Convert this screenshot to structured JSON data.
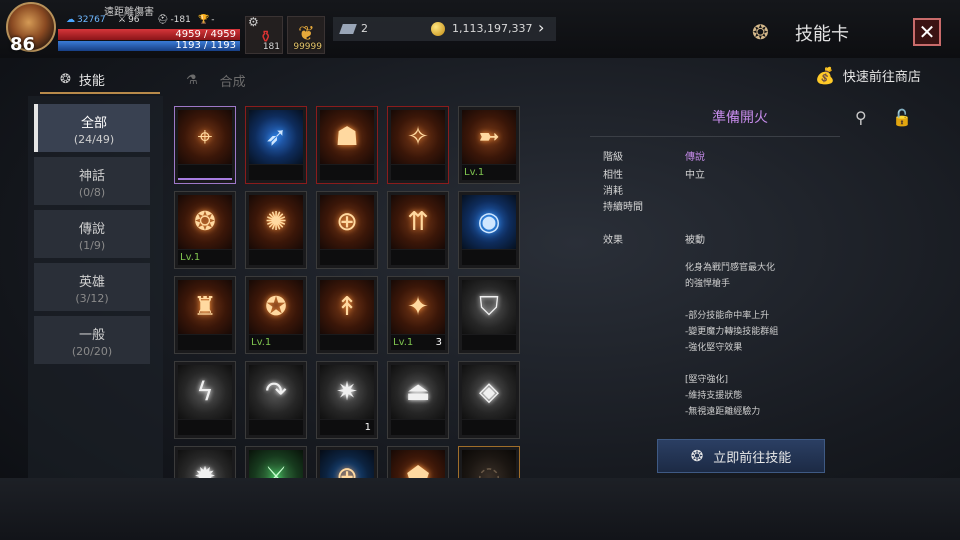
{
  "player": {
    "level": "86",
    "title": "遠距離傷害",
    "power": "32767",
    "stat_attack": "96",
    "stat_defense": "-181",
    "stat_trophy": "-",
    "hp": "4959 / 4959",
    "mp": "1193 / 1193",
    "potion_count": "181",
    "item_count": "99999"
  },
  "currency": {
    "gem_count": "2",
    "gold": "1,113,197,337"
  },
  "header": {
    "screen_title": "技能卡",
    "close_label": "✕"
  },
  "tabs": [
    {
      "label": "技能",
      "active": true
    },
    {
      "label": "合成",
      "active": false
    }
  ],
  "shop_link": "快速前往商店",
  "filters": [
    {
      "name": "全部",
      "count": "(24/49)",
      "active": true
    },
    {
      "name": "神話",
      "count": "(0/8)",
      "active": false
    },
    {
      "name": "傳說",
      "count": "(1/9)",
      "active": false
    },
    {
      "name": "英雄",
      "count": "(3/12)",
      "active": false
    },
    {
      "name": "一般",
      "count": "(20/20)",
      "active": false
    }
  ],
  "skills": [
    {
      "icon": "crosshair-shooter-icon",
      "glyph": "⌖",
      "style": "b-sel",
      "label": "",
      "num": ""
    },
    {
      "icon": "blue-dash-icon",
      "glyph": "➶",
      "style": "blue b-red",
      "label": "",
      "num": ""
    },
    {
      "icon": "demon-card-icon",
      "glyph": "☗",
      "style": "b-red",
      "label": "",
      "num": ""
    },
    {
      "icon": "shattered-ammo-icon",
      "glyph": "✧",
      "style": "b-red",
      "label": "",
      "num": ""
    },
    {
      "icon": "bullet-rush-icon",
      "glyph": "➼",
      "style": "",
      "label": "Lv.1",
      "num": ""
    },
    {
      "icon": "whirlwind-icon",
      "glyph": "❂",
      "style": "",
      "label": "Lv.1",
      "num": ""
    },
    {
      "icon": "explosion-icon",
      "glyph": "✺",
      "style": "",
      "label": "",
      "num": ""
    },
    {
      "icon": "stat-boost-icon",
      "glyph": "⊕",
      "style": "",
      "label": "",
      "num": ""
    },
    {
      "icon": "speed-up-icon",
      "glyph": "⇈",
      "style": "",
      "label": "",
      "num": ""
    },
    {
      "icon": "blue-whirl-icon",
      "glyph": "◉",
      "style": "blue",
      "label": "",
      "num": ""
    },
    {
      "icon": "armor-icon",
      "glyph": "♜",
      "style": "",
      "label": "",
      "num": ""
    },
    {
      "icon": "rage-body-icon",
      "glyph": "✪",
      "style": "",
      "label": "Lv.1",
      "num": ""
    },
    {
      "icon": "power-up-icon",
      "glyph": "↟",
      "style": "",
      "label": "",
      "num": ""
    },
    {
      "icon": "burst-shot-icon",
      "glyph": "✦",
      "style": "",
      "label": "Lv.1",
      "num": "3"
    },
    {
      "icon": "shield-icon",
      "glyph": "⛉",
      "style": "gray",
      "label": "",
      "num": ""
    },
    {
      "icon": "lightning-icon",
      "glyph": "ϟ",
      "style": "gray",
      "label": "",
      "num": ""
    },
    {
      "icon": "curve-arrow-icon",
      "glyph": "↷",
      "style": "gray",
      "label": "",
      "num": ""
    },
    {
      "icon": "spark-icon",
      "glyph": "✷",
      "style": "gray",
      "label": "",
      "num": "1"
    },
    {
      "icon": "anvil-icon",
      "glyph": "⏏",
      "style": "gray",
      "label": "",
      "num": ""
    },
    {
      "icon": "eye-slash-icon",
      "glyph": "◈",
      "style": "gray",
      "label": "",
      "num": ""
    },
    {
      "icon": "gear-burst-icon",
      "glyph": "✹",
      "style": "gray",
      "label": "",
      "num": ""
    },
    {
      "icon": "green-blade-icon",
      "glyph": "⚔",
      "style": "green",
      "label": "",
      "num": ""
    },
    {
      "icon": "blue-boost-icon",
      "glyph": "⊕",
      "style": "bluegold",
      "label": "",
      "num": ""
    },
    {
      "icon": "red-badge-icon",
      "glyph": "⬟",
      "style": "",
      "label": "",
      "num": ""
    },
    {
      "icon": "locked-card-icon",
      "glyph": "◌",
      "style": "dark b-gold",
      "label": "",
      "num": ""
    }
  ],
  "detail": {
    "title": "準備開火",
    "rows": [
      {
        "label": "階級",
        "value": "傳說"
      },
      {
        "label": "相性",
        "value": "中立"
      },
      {
        "label": "消耗",
        "value": ""
      },
      {
        "label": "持續時間",
        "value": ""
      },
      {
        "label": "效果",
        "value": "被動"
      }
    ],
    "description": "化身為戰鬥感官最大化\n的強悍槍手\n\n-部分技能命中率上升\n-變更魔力轉換技能群組\n-強化堅守效果\n\n[堅守強化]\n-維持支援狀態\n-無視遠距離經驗力",
    "go_button": "立即前往技能"
  }
}
